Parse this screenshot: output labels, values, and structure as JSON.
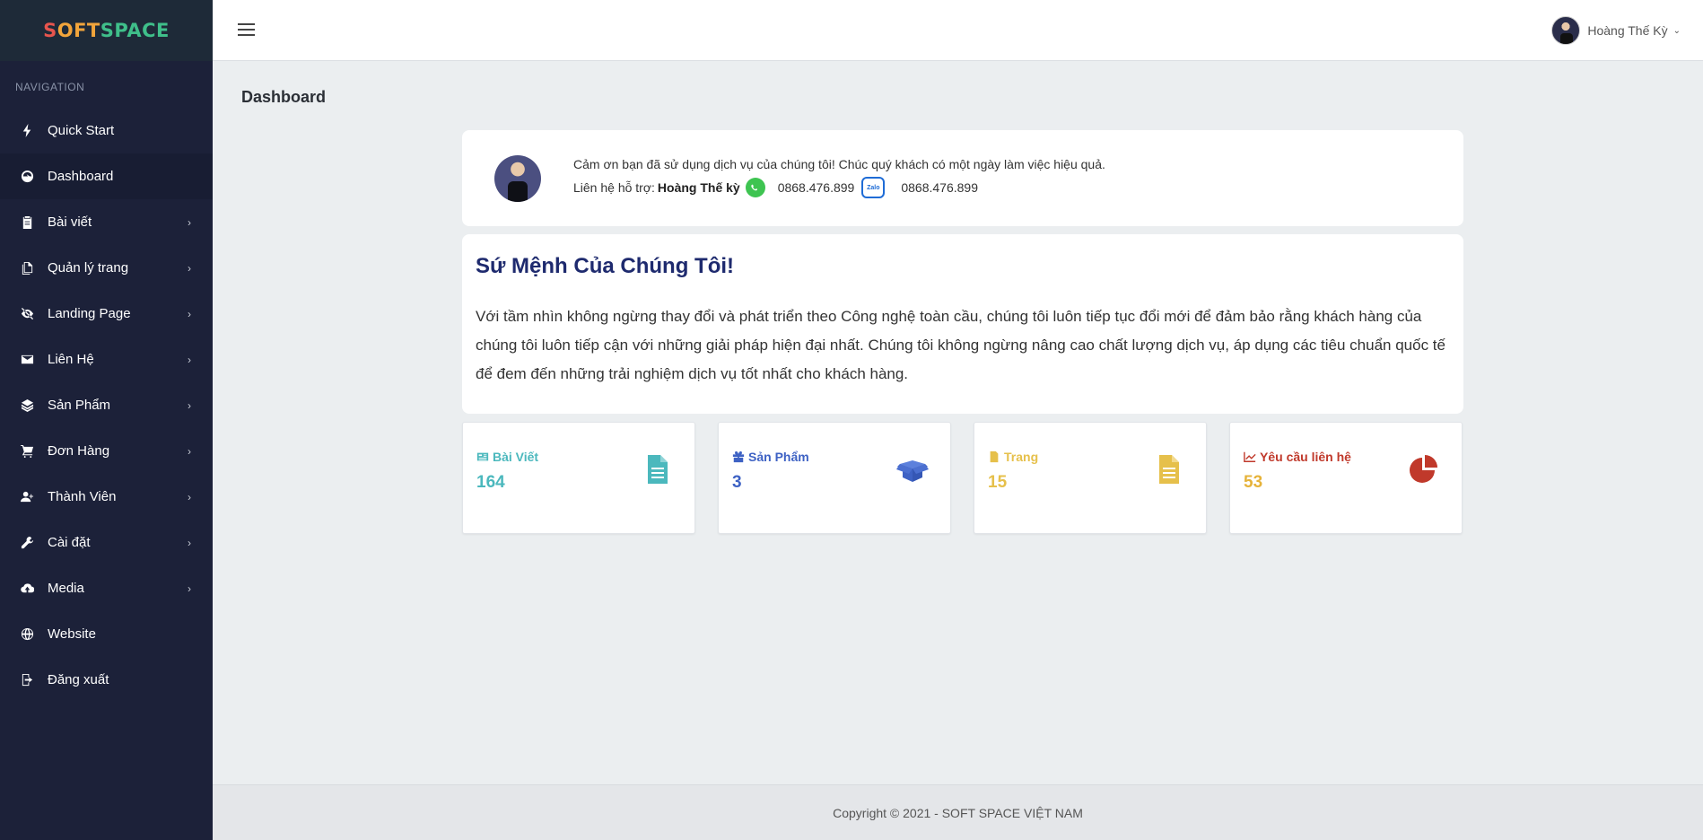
{
  "brand": {
    "first_letter": "S",
    "part1": "OFT",
    "part2": "SPACE"
  },
  "sidebar": {
    "heading": "NAVIGATION",
    "items": [
      {
        "label": "Quick Start",
        "icon": "bolt-icon",
        "has_children": false,
        "active": false
      },
      {
        "label": "Dashboard",
        "icon": "gauge-icon",
        "has_children": false,
        "active": true
      },
      {
        "label": "Bài viết",
        "icon": "clipboard-icon",
        "has_children": true,
        "active": false
      },
      {
        "label": "Quản lý trang",
        "icon": "file-copy-icon",
        "has_children": true,
        "active": false
      },
      {
        "label": "Landing Page",
        "icon": "eye-slash-icon",
        "has_children": true,
        "active": false
      },
      {
        "label": "Liên Hệ",
        "icon": "envelope-icon",
        "has_children": true,
        "active": false
      },
      {
        "label": "Sản Phẩm",
        "icon": "layers-icon",
        "has_children": true,
        "active": false
      },
      {
        "label": "Đơn Hàng",
        "icon": "cart-icon",
        "has_children": true,
        "active": false
      },
      {
        "label": "Thành Viên",
        "icon": "user-plus-icon",
        "has_children": true,
        "active": false
      },
      {
        "label": "Cài đặt",
        "icon": "wrench-icon",
        "has_children": true,
        "active": false
      },
      {
        "label": "Media",
        "icon": "cloud-upload-icon",
        "has_children": true,
        "active": false
      },
      {
        "label": "Website",
        "icon": "globe-icon",
        "has_children": false,
        "active": false
      },
      {
        "label": "Đăng xuất",
        "icon": "sign-out-icon",
        "has_children": false,
        "active": false
      }
    ]
  },
  "header": {
    "user_name": "Hoàng Thế Kỳ",
    "user_caret": "⌄"
  },
  "page": {
    "title": "Dashboard"
  },
  "welcome": {
    "message": "Cảm ơn bạn đã sử dụng dịch vụ của chúng tôi! Chúc quý khách có một ngày làm việc hiệu quả.",
    "support_label": "Liên hệ hỗ trợ:",
    "support_name": "Hoàng Thế kỳ",
    "whatsapp_phone": "0868.476.899",
    "zalo_label": "Zalo",
    "zalo_phone": "0868.476.899"
  },
  "mission": {
    "title": "Sứ Mệnh Của Chúng Tôi!",
    "body": "Với tầm nhìn không ngừng thay đổi và phát triển theo Công nghệ toàn cầu, chúng tôi luôn tiếp tục đổi mới để đảm bảo rằng khách hàng của chúng tôi luôn tiếp cận với những giải pháp hiện đại nhất. Chúng tôi không ngừng nâng cao chất lượng dịch vụ, áp dụng các tiêu chuẩn quốc tế để đem đến những trải nghiệm dịch vụ tốt nhất cho khách hàng."
  },
  "stats": [
    {
      "label": "Bài Viết",
      "value": "164",
      "color": "#4bb8bd",
      "icon": "document-icon"
    },
    {
      "label": "Sản Phẩm",
      "value": "3",
      "color": "#3e62c4",
      "icon": "box-open-icon"
    },
    {
      "label": "Trang",
      "value": "15",
      "color": "#e6c04b",
      "icon": "file-icon"
    },
    {
      "label": "Yêu cầu liên hệ",
      "value": "53",
      "color": "#c0392b",
      "icon": "pie-chart-icon"
    }
  ],
  "footer": {
    "copyright": "Copyright © 2021 - SOFT SPACE VIỆT NAM"
  }
}
